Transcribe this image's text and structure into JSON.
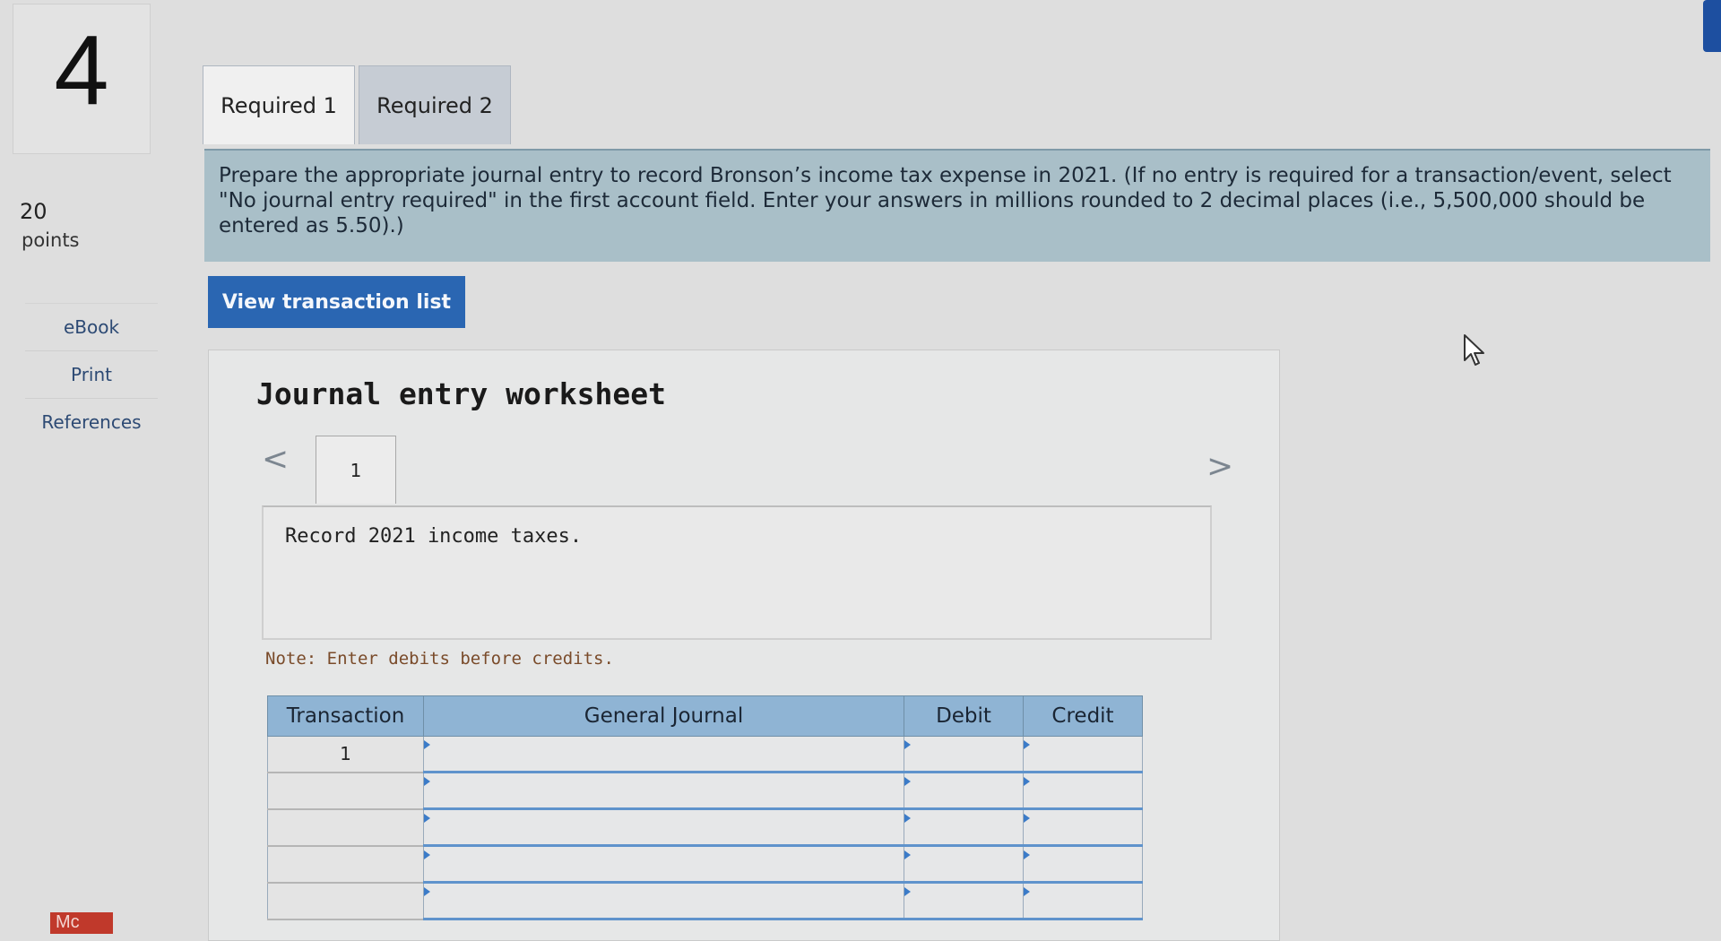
{
  "question": {
    "number": "4",
    "points_value": "20",
    "points_label": "points"
  },
  "sidebar": {
    "items": [
      {
        "label": "eBook"
      },
      {
        "label": "Print"
      },
      {
        "label": "References"
      }
    ]
  },
  "footer_badge": "Mc",
  "tabs": [
    {
      "label": "Required 1",
      "active": true
    },
    {
      "label": "Required 2",
      "active": false
    }
  ],
  "instruction": "Prepare the appropriate journal entry to record Bronson’s income tax expense in 2021. (If no entry is required for a transaction/event, select \"No journal entry required\" in the first account field. Enter your answers in millions rounded to 2 decimal places (i.e., 5,500,000 should be entered as 5.50).)",
  "view_button_label": "View transaction list",
  "worksheet": {
    "title": "Journal entry worksheet",
    "prev_arrow": "<",
    "next_arrow": ">",
    "entry_tab_label": "1",
    "record_text": "Record 2021 income taxes.",
    "note": "Note: Enter debits before credits."
  },
  "journal_table": {
    "headers": {
      "transaction": "Transaction",
      "general_journal": "General Journal",
      "debit": "Debit",
      "credit": "Credit"
    },
    "rows": [
      {
        "transaction": "1"
      },
      {
        "transaction": ""
      },
      {
        "transaction": ""
      },
      {
        "transaction": ""
      },
      {
        "transaction": ""
      }
    ]
  },
  "colors": {
    "button_blue": "#2a66b2",
    "table_header": "#8fb4d4",
    "instruction_band": "#a9bfc8"
  }
}
